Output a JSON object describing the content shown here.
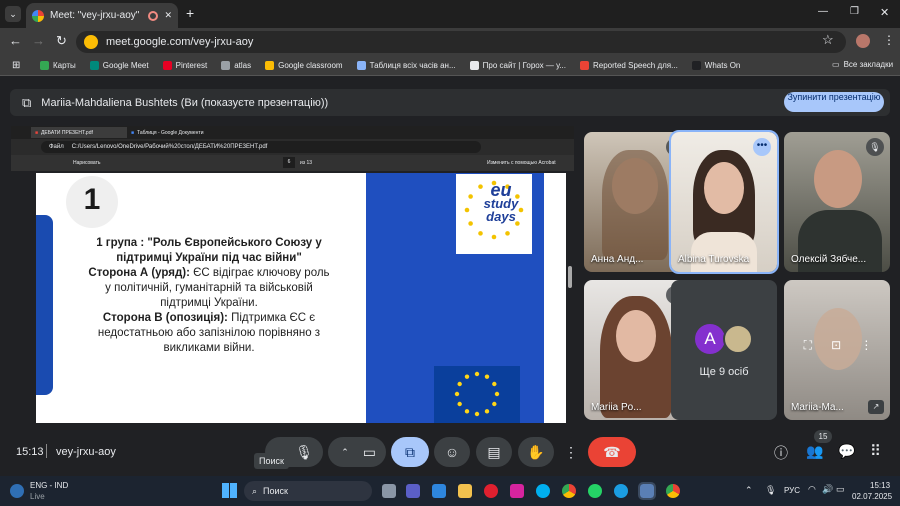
{
  "browser": {
    "tab_title": "Meet: \"vey-jrxu-aoy\"",
    "close_glyph": "✕",
    "new_tab_glyph": "+",
    "url": "meet.google.com/vey-jrxu-aoy",
    "window_controls": [
      "—",
      "❐",
      "✕"
    ],
    "bookmarks": [
      {
        "label": "Карты",
        "color": "#34a853"
      },
      {
        "label": "Google Meet",
        "color": "#00897b"
      },
      {
        "label": "Pinterest",
        "color": "#e60023"
      },
      {
        "label": "atlas",
        "color": "#9aa0a6"
      },
      {
        "label": "Google classroom",
        "color": "#fbbc05"
      },
      {
        "label": "Таблиця всіх часів ан...",
        "color": "#8ab4f8"
      },
      {
        "label": "Про сайт | Горох — у...",
        "color": "#e8eaed"
      },
      {
        "label": "Reported Speech для...",
        "color": "#ea4335"
      },
      {
        "label": "Whats On",
        "color": "#202124"
      }
    ],
    "all_bookmarks": "Все закладки"
  },
  "banner": {
    "text": "Mariia-Mahdaliena Bushtets (Ви (показуєте презентацію))",
    "stop_label": "Зупинити презентацію"
  },
  "pdf": {
    "tabs": [
      "ДЕБАТИ ПРЕЗЕНТ.pdf",
      "Таблиця - Google Документи"
    ],
    "file_label": "Файл",
    "path": "C:/Users/Lenovo/OneDrive/Рабочий%20стол/ДЕБАТИ%20ПРЕЗЕНТ.pdf",
    "draw_label": "Нарисовать",
    "page_current": "6",
    "page_total": "из 13",
    "acrobat": "Изменить с помощью Acrobat"
  },
  "slide": {
    "number": "1",
    "line1": "1 група : \"Роль Європейського Союзу у підтримці України під час війни\"",
    "side_a_label": "Сторона А (уряд):",
    "side_a_text": " ЄС відіграє ключову роль у політичній, гуманітарній та військовій підтримці України.",
    "side_b_label": "Сторона В (опозиція):",
    "side_b_text": " Підтримка ЄС є недостатньою або запізнілою порівняно з викликами війни.",
    "logo": [
      "eu",
      "study",
      "days"
    ]
  },
  "participants": [
    {
      "name": "Анна Анд...",
      "muted": true
    },
    {
      "name": "Albina Turovska",
      "muted": false
    },
    {
      "name": "Олексій Зябче...",
      "muted": true
    },
    {
      "name": "Mariia Po...",
      "muted": true
    },
    {
      "name": "Ще 9 осіб",
      "avatar": "A"
    },
    {
      "name": "Mariia-Ma...",
      "muted": false
    }
  ],
  "controls": {
    "time": "15:13",
    "meeting_code": "vey-jrxu-aoy",
    "tooltip": "Поиск",
    "people_count": "15"
  },
  "taskbar": {
    "lang": "ENG - IND",
    "live": "Live",
    "search_placeholder": "Поиск",
    "input_lang": "РУС",
    "clock_time": "15:13",
    "clock_date": "02.07.2025"
  },
  "colors": {
    "end_call": "#ea4335",
    "present_active": "#a8c7fa",
    "bg": "#202124"
  }
}
